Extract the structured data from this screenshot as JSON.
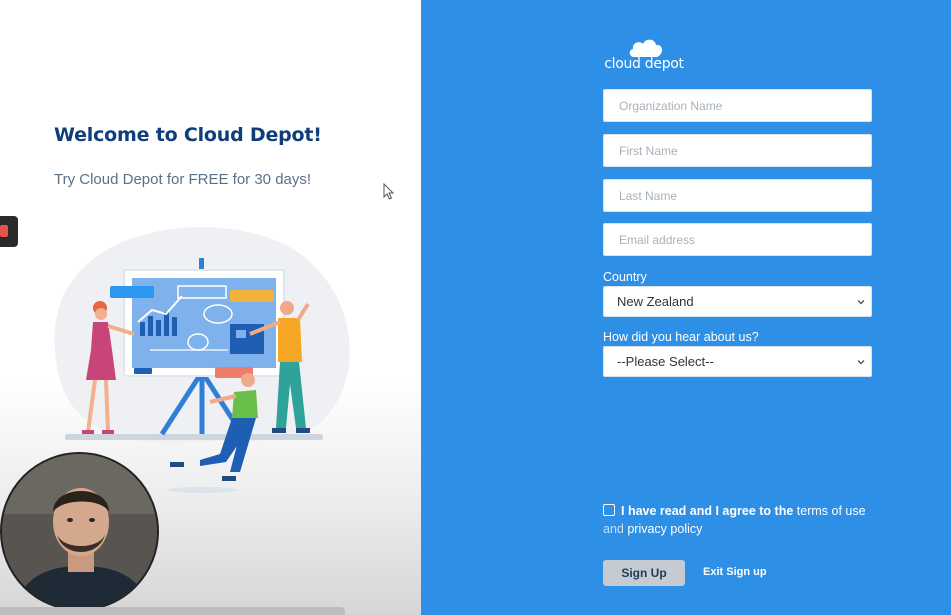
{
  "welcome": {
    "title": "Welcome to Cloud Depot!",
    "subtitle": "Try Cloud Depot for FREE for 30 days!"
  },
  "brand": {
    "logo_text": "cloud depot",
    "panel_color": "#2d8fe6",
    "title_color": "#0f3f7a"
  },
  "form": {
    "organization_placeholder": "Organization Name",
    "first_name_placeholder": "First Name",
    "last_name_placeholder": "Last Name",
    "email_placeholder": "Email address",
    "country_label": "Country",
    "country_value": "New Zealand",
    "hear_label": "How did you hear about us?",
    "hear_value": "--Please Select--",
    "agree_prefix": "I have read and I agree to the",
    "terms_link": "terms of use",
    "and_text": "and",
    "privacy_link": "privacy policy",
    "signup_label": "Sign Up",
    "exit_label": "Exit Sign up"
  },
  "icons": {
    "logo": "cloud-icon",
    "select_arrow": "chevron-down-icon",
    "pointer": "mouse-cursor-icon"
  }
}
